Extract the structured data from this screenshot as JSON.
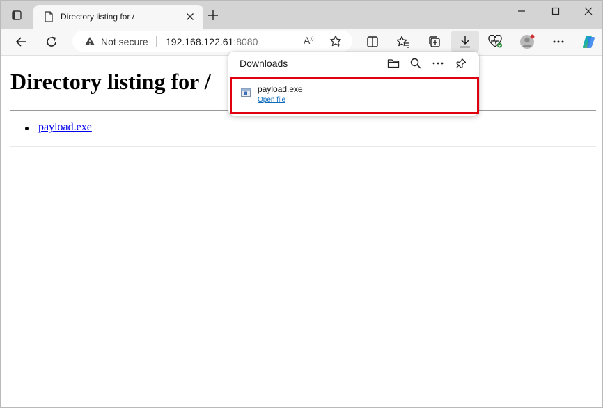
{
  "tab": {
    "title": "Directory listing for /"
  },
  "address_bar": {
    "security_label": "Not secure",
    "host": "192.168.122.61",
    "port": ":8080"
  },
  "page": {
    "heading": "Directory listing for /",
    "files": [
      "payload.exe"
    ]
  },
  "downloads_panel": {
    "title": "Downloads",
    "items": [
      {
        "filename": "payload.exe",
        "action_label": "Open file"
      }
    ]
  },
  "colors": {
    "highlight_border": "#e0000e",
    "link": "#0000ee",
    "accent_link": "#0f6cbd"
  },
  "icons": {
    "window": [
      "tab-actions-icon",
      "page-favicon-icon",
      "tab-close-icon",
      "new-tab-icon",
      "minimize-icon",
      "maximize-icon",
      "window-close-icon"
    ],
    "toolbar": [
      "back-icon",
      "refresh-icon",
      "warning-icon",
      "read-aloud-icon",
      "add-favorite-icon",
      "split-screen-icon",
      "favorites-icon",
      "collections-icon",
      "download-icon",
      "browser-essentials-icon",
      "profile-icon",
      "more-icon",
      "copilot-icon"
    ],
    "downloads": [
      "open-folder-icon",
      "search-icon",
      "more-options-icon",
      "pin-icon",
      "exe-file-icon"
    ]
  }
}
